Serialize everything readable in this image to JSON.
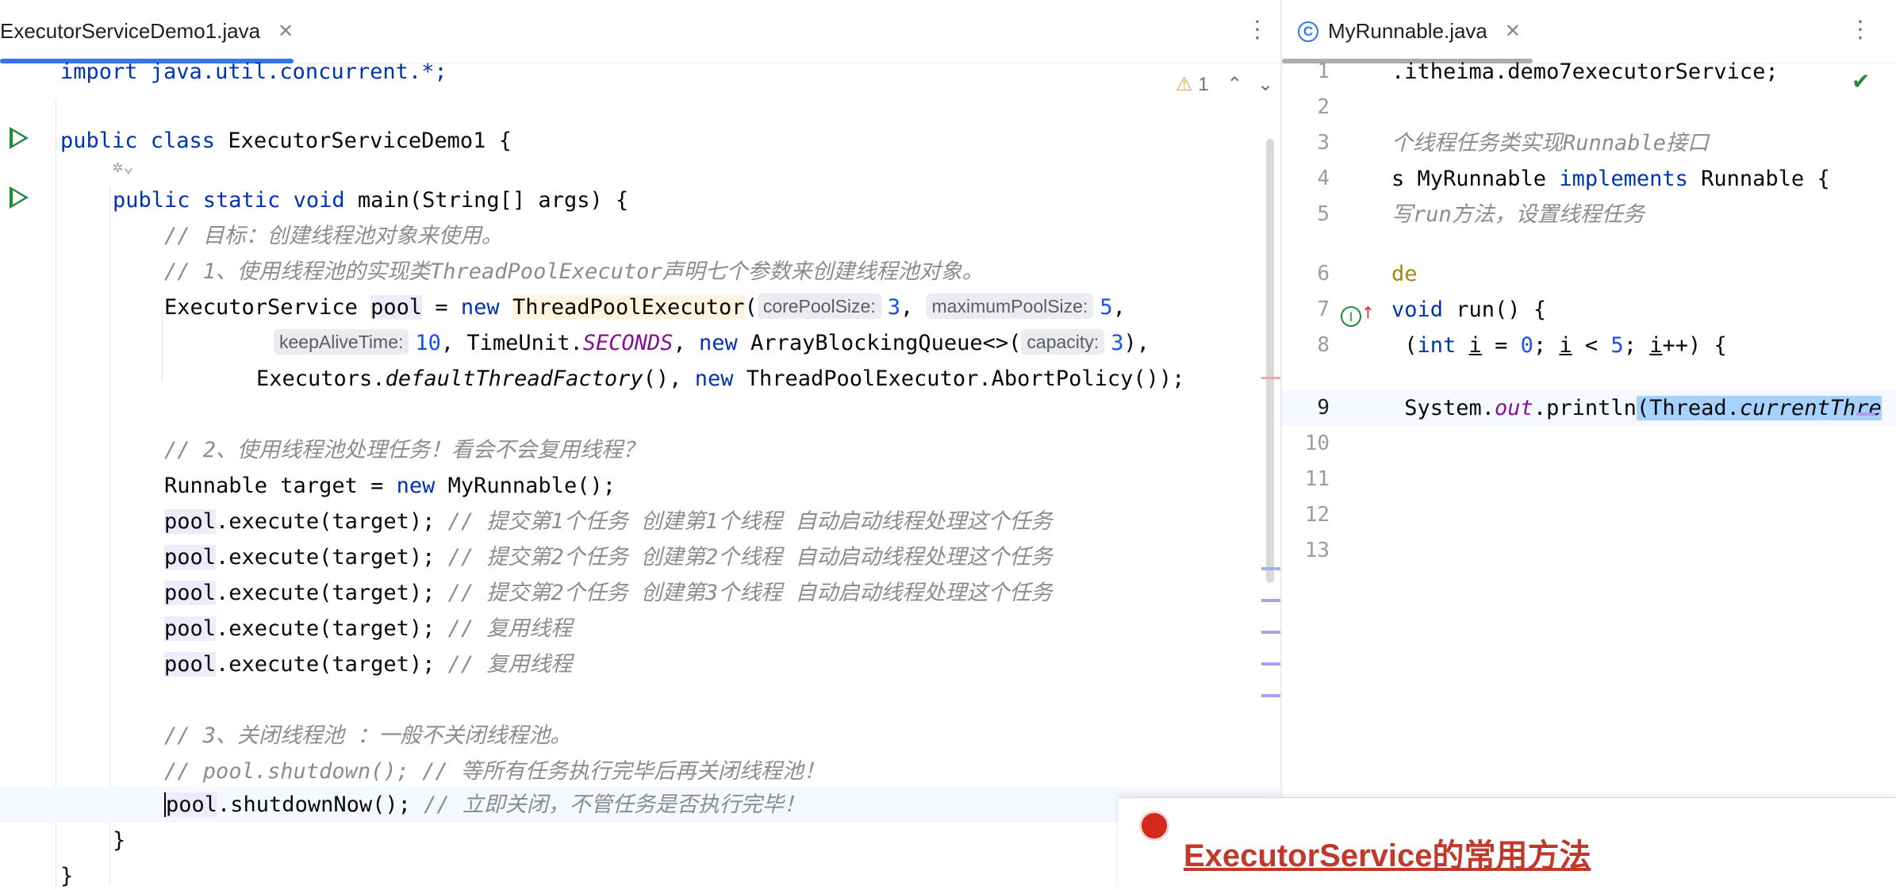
{
  "left_editor": {
    "tab_label": "ExecutorServiceDemo1.java",
    "warning_count": "1",
    "lines": {
      "l0": "import java.util.concurrent.*;",
      "l2_kw": "public class ",
      "l2_rest": "ExecutorServiceDemo1 {",
      "l4_kw": "public static void ",
      "l4_rest": "main(String[] args) {",
      "l5": "// 目标：创建线程池对象来使用。",
      "l6": "// 1、使用线程池的实现类ThreadPoolExecutor声明七个参数来创建线程池对象。",
      "l7_a": "ExecutorService ",
      "l7_pool": "pool",
      "l7_b": " = ",
      "l7_new": "new ",
      "l7_cls": "ThreadPoolExecutor",
      "l7_c": "(",
      "hint_core": "corePoolSize:",
      "l7_n3": "3",
      "l7_d": ", ",
      "hint_max": "maximumPoolSize:",
      "l7_n5": "5",
      "l7_e": ",",
      "hint_keep": "keepAliveTime:",
      "l8_n10": "10",
      "l8_a": ", TimeUnit.",
      "l8_sec": "SECONDS",
      "l8_b": ", ",
      "l8_new": "new ",
      "l8_c": "ArrayBlockingQueue<>(",
      "hint_cap": "capacity:",
      "l8_n3": "3",
      "l8_d": "),",
      "l9_a": "Executors.",
      "l9_fac": "defaultThreadFactory",
      "l9_b": "(), ",
      "l9_new": "new ",
      "l9_c": "ThreadPoolExecutor.AbortPolicy());",
      "l11": "// 2、使用线程池处理任务！看会不会复用线程？",
      "l12_a": "Runnable target = ",
      "l12_new": "new ",
      "l12_b": "MyRunnable();",
      "pool": "pool",
      "exec": ".execute(target); ",
      "c13": "// 提交第1个任务 创建第1个线程 自动启动线程处理这个任务",
      "c14": "// 提交第2个任务 创建第2个线程 自动启动线程处理这个任务",
      "c15": "// 提交第2个任务 创建第3个线程 自动启动线程处理这个任务",
      "c16": "// 复用线程",
      "c17": "// 复用线程",
      "l19": "// 3、关闭线程池 ：一般不关闭线程池。",
      "l20": "// pool.shutdown(); // 等所有任务执行完毕后再关闭线程池！",
      "l21_b": ".shutdownNow(); ",
      "l21_c": "// 立即关闭，不管任务是否执行完毕！",
      "l22": "}",
      "l23": "}"
    }
  },
  "right_editor": {
    "tab_label": "MyRunnable.java",
    "line_numbers": [
      "1",
      "2",
      "3",
      "4",
      "5",
      "6",
      "7",
      "8",
      "9",
      "10",
      "11",
      "12",
      "13"
    ],
    "lines": {
      "r1": ".itheima.demo7executorService;",
      "r3": "个线程任务类实现Runnable接口",
      "r4_a": "s MyRunnable ",
      "r4_kw": "implements ",
      "r4_b": "Runnable {",
      "r5": "写run方法，设置线程任务",
      "r6": "de",
      "r7_kw": "void ",
      "r7_b": "run() {",
      "r8_a": " (",
      "r8_kw": "int ",
      "r8_i": "i",
      "r8_b": " = ",
      "r8_n0": "0",
      "r8_c": "; ",
      "r8_i2": "i",
      "r8_d": " < ",
      "r8_n5": "5",
      "r8_e": "; ",
      "r8_i3": "i",
      "r8_f": "++) {",
      "r9_a": " System.",
      "r9_out": "out",
      "r9_b": ".println",
      "r9_sel_a": "(Thread.",
      "r9_sel_b": "currentThre"
    }
  },
  "caption": {
    "title": "ExecutorService的常用方法"
  },
  "colors": {
    "keyword": "#0033b3",
    "comment": "#8c8c8c",
    "number": "#1750eb",
    "accent": "#3574f0",
    "run": "#208a3c",
    "caption": "#c0392b"
  }
}
